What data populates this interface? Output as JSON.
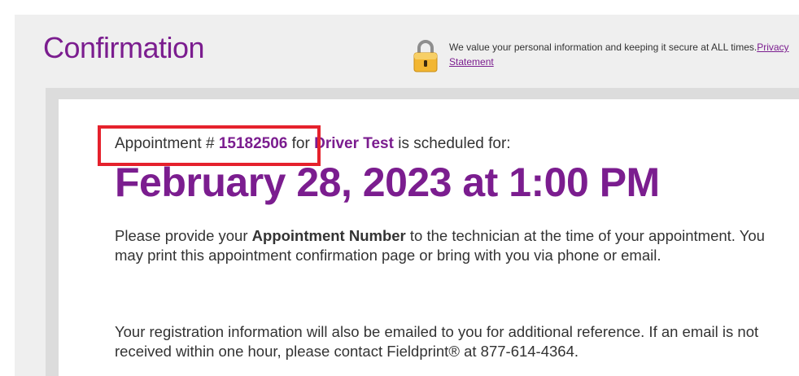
{
  "header": {
    "title": "Confirmation",
    "privacy_text": "We value your personal information and keeping it secure at ALL times.",
    "privacy_link": "Privacy Statement",
    "lock_icon": "padlock-icon"
  },
  "appointment": {
    "prefix": "Appointment # ",
    "number": "15182506",
    "for_text": " for ",
    "service": "Driver Test",
    "suffix": " is scheduled for:",
    "datetime": "February 28, 2023 at 1:00 PM"
  },
  "instructions": {
    "p1_before": "Please provide your ",
    "p1_bold": "Appointment Number",
    "p1_after": " to the technician at the time of your appointment. You may print this appointment confirmation page or bring with you via phone or email.",
    "p2": "Your registration information will also be emailed to you for additional reference. If an email is not received within one hour, please contact Fieldprint® at 877-614-4364."
  },
  "colors": {
    "brand_purple": "#7b1d8f",
    "highlight_red": "#e5212c",
    "lock_gold": "#f2b632"
  }
}
